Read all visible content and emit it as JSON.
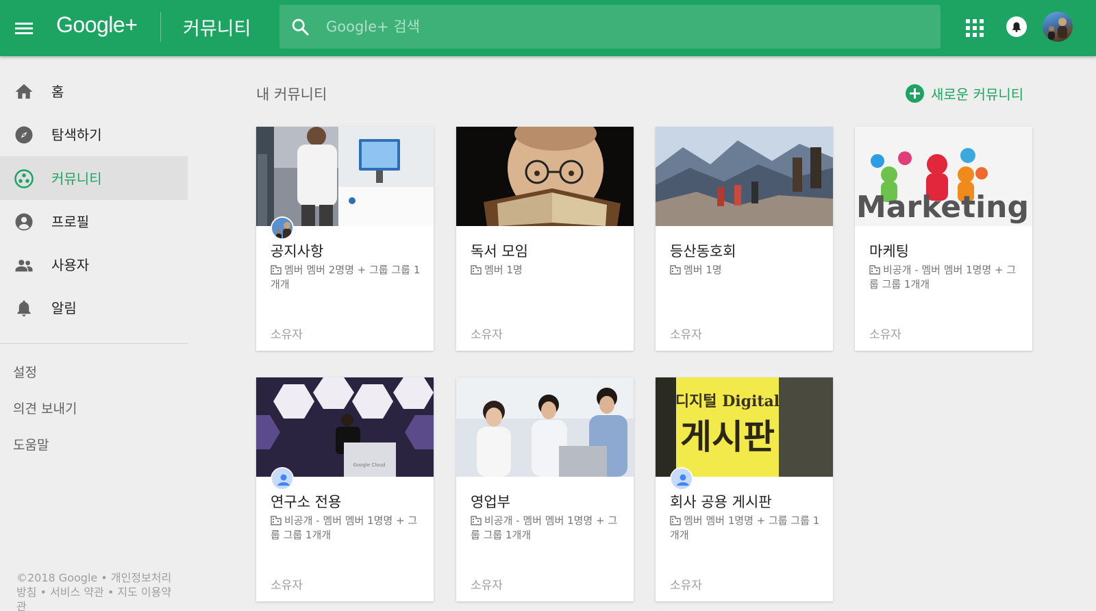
{
  "header": {
    "logo": "Google+",
    "page_title": "커뮤니티",
    "search_placeholder": "Google+ 검색"
  },
  "sidebar": {
    "items": [
      {
        "label": "홈",
        "icon": "home-icon"
      },
      {
        "label": "탐색하기",
        "icon": "compass-icon"
      },
      {
        "label": "커뮤니티",
        "icon": "communities-icon",
        "active": true
      },
      {
        "label": "프로필",
        "icon": "profile-icon"
      },
      {
        "label": "사용자",
        "icon": "people-icon"
      },
      {
        "label": "알림",
        "icon": "bell-icon"
      }
    ],
    "links": [
      "설정",
      "의견 보내기",
      "도움말"
    ],
    "footer": {
      "copyright": "©2018 Google",
      "privacy": "개인정보처리방침",
      "terms": "서비스 약관",
      "maps_terms": "지도 이용약관"
    }
  },
  "main": {
    "title": "내 커뮤니티",
    "new_community_label": "새로운 커뮤니티",
    "cards": [
      {
        "name": "공지사항",
        "meta": "멤버 멤버 2명명 + 그룹 그룹 1개개",
        "role": "소유자"
      },
      {
        "name": "독서 모임",
        "meta": "멤버 1명",
        "role": "소유자"
      },
      {
        "name": "등산동호회",
        "meta": "멤버 1명",
        "role": "소유자"
      },
      {
        "name": "마케팅",
        "meta": "비공개 - 멤버 멤버 1명명 + 그룹 그룹 1개개",
        "role": "소유자",
        "thumb_text": "Marketing"
      },
      {
        "name": "연구소 전용",
        "meta": "비공개 - 멤버 멤버 1명명 + 그룹 그룹 1개개",
        "role": "소유자",
        "thumb_text": "Google Cloud"
      },
      {
        "name": "영업부",
        "meta": "비공개 - 멤버 멤버 1명명 + 그룹 그룹 1개개",
        "role": "소유자"
      },
      {
        "name": "회사 공용 게시판",
        "meta": "멤버 멤버 1명명 + 그룹 그룹 1개개",
        "role": "소유자",
        "thumb_text": "디지털 Digital 게시판"
      }
    ]
  },
  "colors": {
    "brand_green": "#1da462",
    "background": "#eeeeee"
  }
}
